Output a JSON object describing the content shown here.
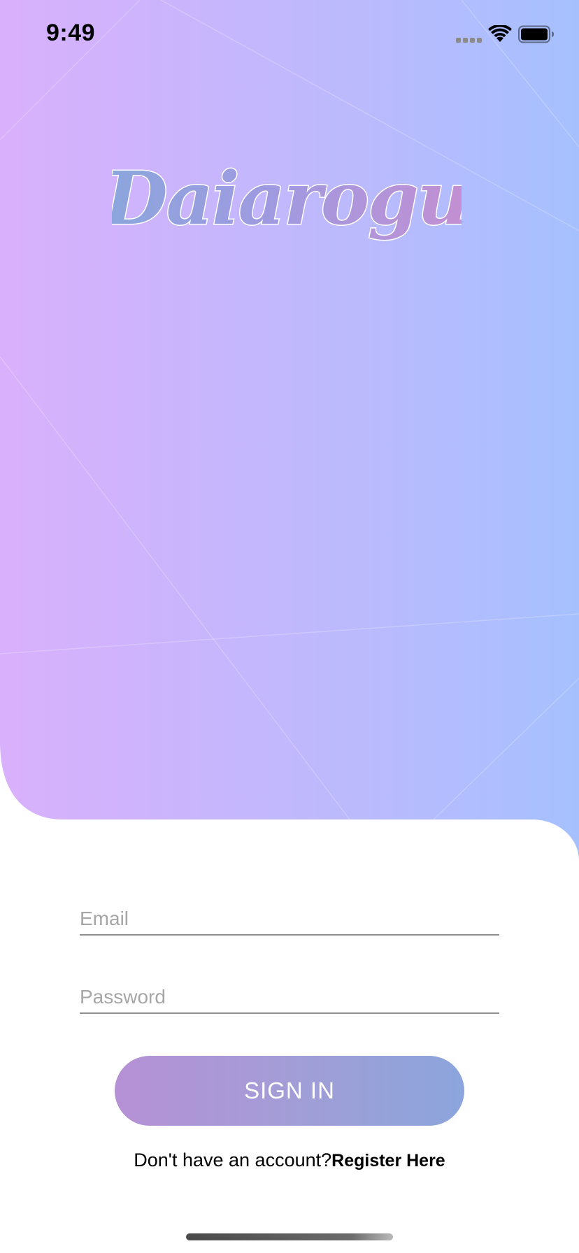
{
  "status_bar": {
    "time": "9:49",
    "icons": [
      "signal-icon",
      "wifi-icon",
      "battery-icon"
    ]
  },
  "logo": {
    "text": "Daiarogu"
  },
  "form": {
    "email_placeholder": "Email",
    "email_value": "",
    "password_placeholder": "Password",
    "password_value": "",
    "signin_label": "SIGN IN"
  },
  "register": {
    "prompt": "Don't have an account?",
    "link_label": "Register Here"
  },
  "colors": {
    "gradient_left": "#d9b0fc",
    "gradient_mid": "#c1b8fd",
    "gradient_right": "#a6c0fe",
    "button_left": "#b591d5",
    "button_right": "#8ba5dc"
  }
}
